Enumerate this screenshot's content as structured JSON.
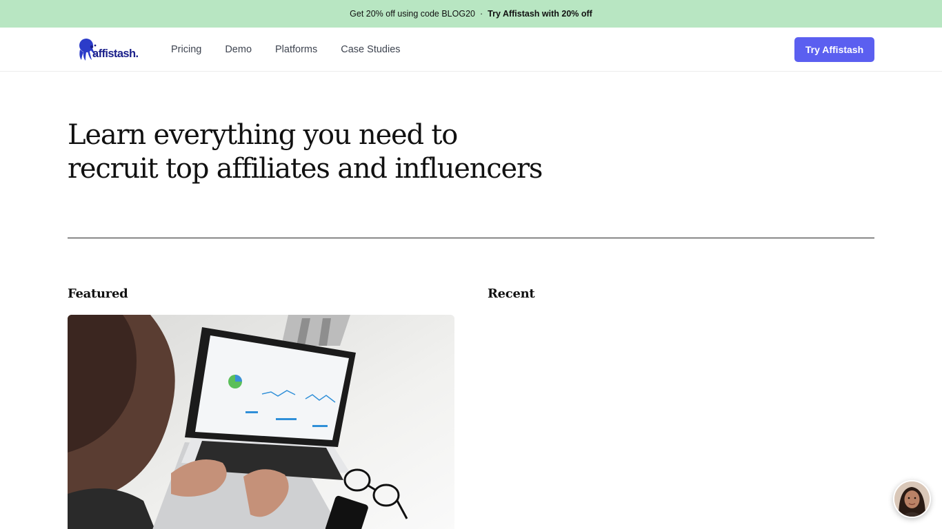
{
  "promo": {
    "text": "Get 20% off using code BLOG20",
    "separator": "·",
    "link_label": "Try Affistash with 20% off"
  },
  "nav": {
    "logo_text": "affistash.",
    "links": [
      {
        "label": "Pricing"
      },
      {
        "label": "Demo"
      },
      {
        "label": "Platforms"
      },
      {
        "label": "Case Studies"
      }
    ],
    "cta_label": "Try Affistash"
  },
  "hero": {
    "title_line1": "Learn everything you need to",
    "title_line2": "recruit top affiliates and influencers"
  },
  "sections": {
    "featured_label": "Featured",
    "recent_label": "Recent"
  },
  "colors": {
    "promo_bg": "#b8e6c2",
    "brand": "#5b5ff0",
    "logo": "#1a1f8a"
  },
  "icons": {
    "logo": "octopus-logo-icon",
    "chat": "support-avatar-icon"
  }
}
